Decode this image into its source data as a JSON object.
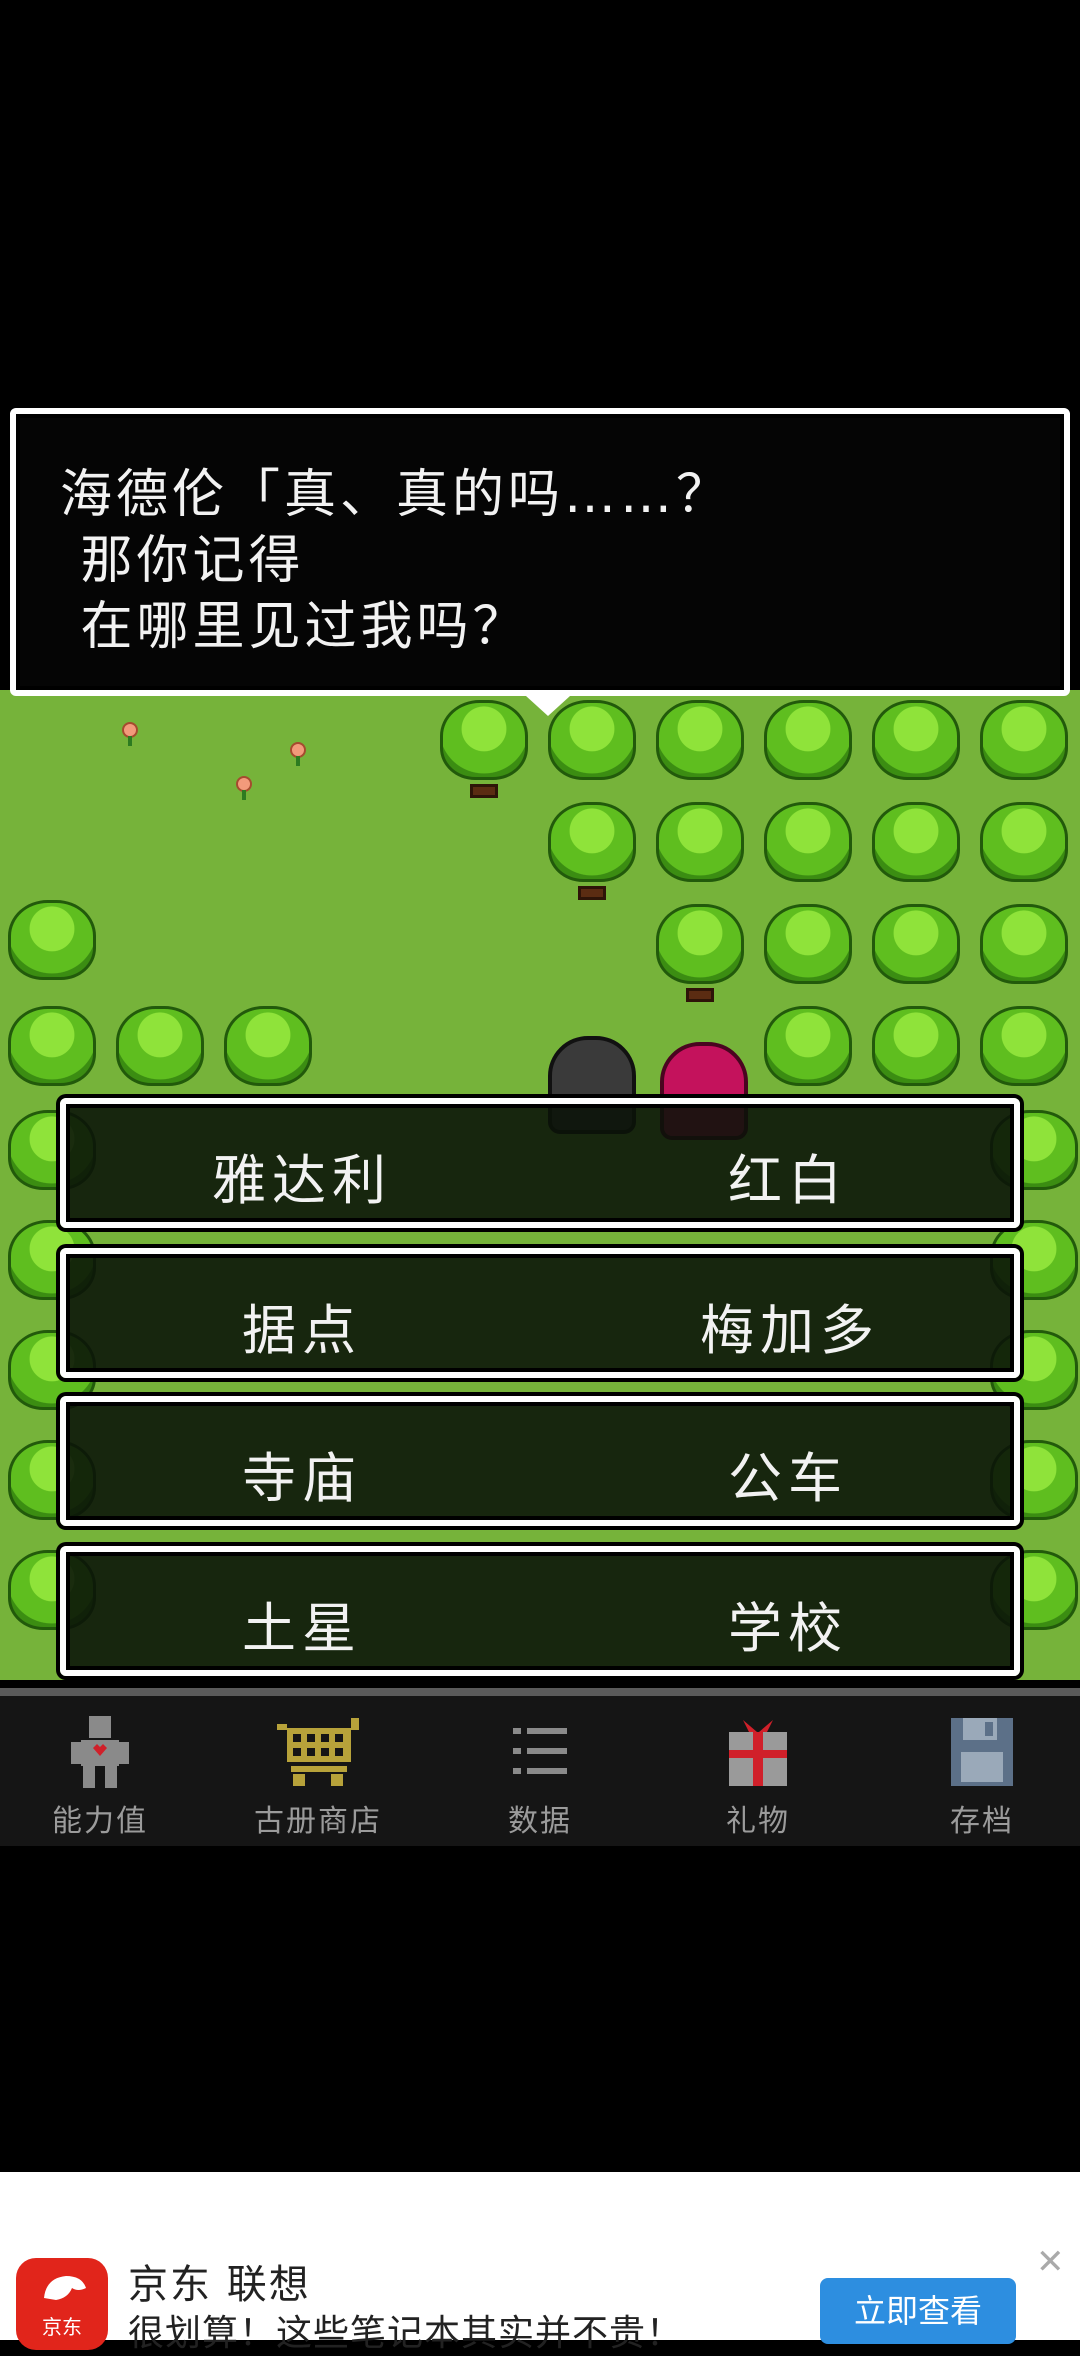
{
  "dialog": {
    "line1": "海德伦「真、真的吗……？",
    "line2": " 那你记得",
    "line3": " 在哪里见过我吗？"
  },
  "choices": [
    {
      "left": "雅达利",
      "right": "红白"
    },
    {
      "left": "据点",
      "right": "梅加多"
    },
    {
      "left": "寺庙",
      "right": "公车"
    },
    {
      "left": "土星",
      "right": "学校"
    }
  ],
  "nav": {
    "stats": "能力值",
    "shop": "古册商店",
    "data": "数据",
    "gift": "礼物",
    "save": "存档"
  },
  "ad": {
    "logo_text": "京东",
    "title": "京东 联想",
    "desc": "很划算！这些笔记本其实并不贵！",
    "button": "立即查看",
    "close": "✕"
  },
  "colors": {
    "grass": "#76b33a",
    "dialog_bg": "#050505",
    "ad_button": "#2d8ee0",
    "ad_logo": "#e1251b"
  }
}
